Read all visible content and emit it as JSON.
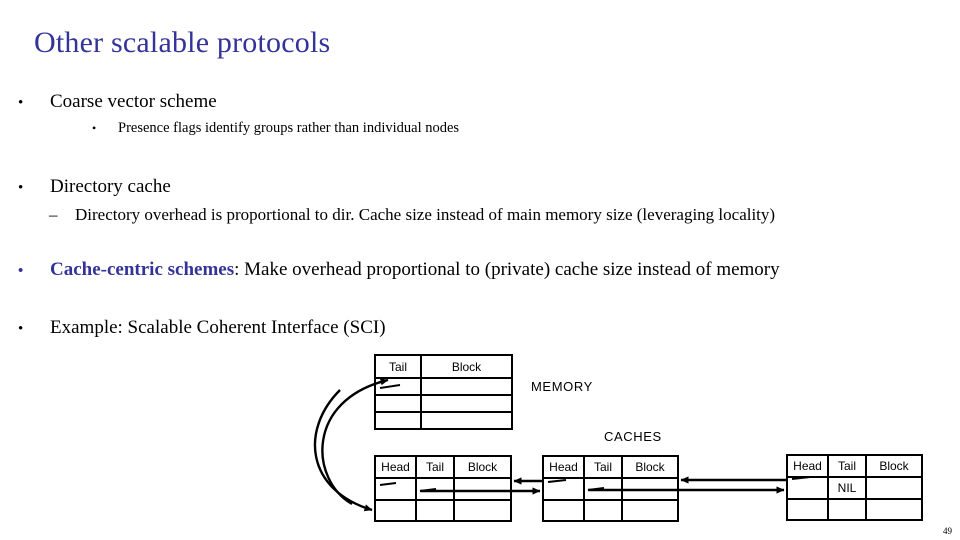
{
  "slide": {
    "title": "Other scalable protocols",
    "page_number": "49",
    "accent_color": "#333399",
    "text_color": "#000000",
    "background_color": "#ffffff"
  },
  "body": {
    "b1": {
      "marker": "•",
      "text": "Coarse vector scheme"
    },
    "b1_sub": {
      "marker": "•",
      "text": "Presence flags identify groups rather than individual nodes"
    },
    "b2": {
      "marker": "•",
      "text": "Directory cache"
    },
    "b2_sub": {
      "marker": "–",
      "text": "Directory overhead is proportional to dir. Cache size instead of main memory size (leveraging locality)"
    },
    "b3": {
      "marker": "•",
      "accent_text": "Cache-centric schemes",
      "rest_text": ":  Make overhead proportional to (private) cache size instead of memory"
    },
    "b4": {
      "marker": "•",
      "text": "Example: Scalable Coherent Interface (SCI)"
    }
  },
  "diagram": {
    "labels": {
      "memory": "MEMORY",
      "caches": "CACHES"
    },
    "memory_table": {
      "headers": [
        "Tail",
        "Block"
      ],
      "rows": [
        [
          "",
          ""
        ],
        [
          "",
          ""
        ],
        [
          "",
          ""
        ]
      ]
    },
    "cache_tables": [
      {
        "name": "cache-table-1",
        "headers": [
          "Head",
          "Tail",
          "Block"
        ],
        "rows": [
          [
            "",
            "",
            ""
          ],
          [
            "",
            "",
            ""
          ]
        ]
      },
      {
        "name": "cache-table-2",
        "headers": [
          "Head",
          "Tail",
          "Block"
        ],
        "rows": [
          [
            "",
            "",
            ""
          ],
          [
            "",
            "",
            ""
          ]
        ]
      },
      {
        "name": "cache-table-3",
        "headers": [
          "Head",
          "Tail",
          "Block"
        ],
        "rows": [
          [
            "",
            "NIL",
            ""
          ],
          [
            "",
            "",
            ""
          ]
        ]
      }
    ]
  }
}
